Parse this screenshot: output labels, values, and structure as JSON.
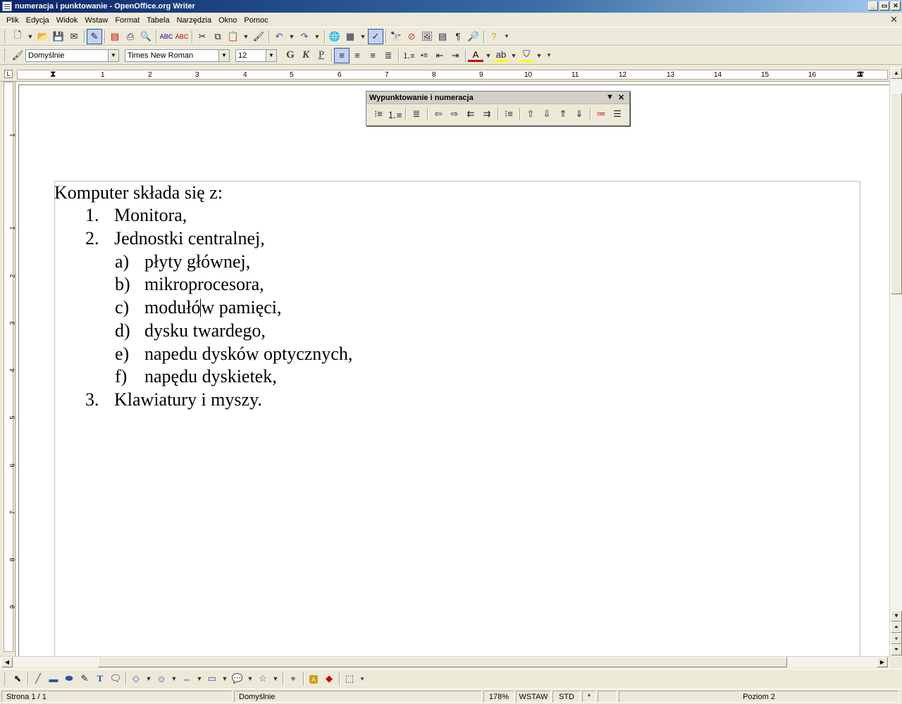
{
  "window": {
    "title": "numeracja i punktowanie - OpenOffice.org Writer",
    "minimize": "_",
    "restore": "▭",
    "close": "✕",
    "doc_close": "✕"
  },
  "menu": [
    {
      "label": "Plik"
    },
    {
      "label": "Edycja"
    },
    {
      "label": "Widok"
    },
    {
      "label": "Wstaw"
    },
    {
      "label": "Format"
    },
    {
      "label": "Tabela"
    },
    {
      "label": "Narzędzia"
    },
    {
      "label": "Okno"
    },
    {
      "label": "Pomoc"
    }
  ],
  "format_toolbar": {
    "style_value": "Domyślnie",
    "font_value": "Times New Roman",
    "size_value": "12",
    "bold": "G",
    "italic": "K",
    "underline": "P"
  },
  "ruler": {
    "h_numbers": [
      "1",
      "2",
      "3",
      "4",
      "5",
      "6",
      "7",
      "8",
      "9",
      "10",
      "11",
      "12",
      "13",
      "14",
      "15",
      "16",
      "17"
    ],
    "v_numbers": [
      "1",
      "1",
      "2",
      "3",
      "4",
      "5",
      "6",
      "7",
      "8",
      "9"
    ]
  },
  "panel": {
    "title": "Wypunktowanie i numeracja",
    "menu_arrow": "▼",
    "close": "✕"
  },
  "document": {
    "intro": "Komputer składa się z:",
    "items": [
      {
        "num": "1.",
        "text": "Monitora,"
      },
      {
        "num": "2.",
        "text": "Jednostki centralnej,"
      },
      {
        "num": "3.",
        "text": "Klawiatury i myszy."
      }
    ],
    "subitems": [
      {
        "num": "a)",
        "text": "płyty głównej,"
      },
      {
        "num": "b)",
        "text": "mikroprocesora,"
      },
      {
        "num": "c)",
        "text_before_cursor": "modułó",
        "text_after_cursor": "w pamięci,"
      },
      {
        "num": "d)",
        "text": "dysku twardego,"
      },
      {
        "num": "e)",
        "text": "napedu dysków optycznych,"
      },
      {
        "num": "f)",
        "text": "napędu dyskietek,"
      }
    ]
  },
  "status": {
    "page": "Strona  1 / 1",
    "style": "Domyślnie",
    "zoom": "178%",
    "mode": "WSTAW",
    "selection": "STD",
    "modified": "*",
    "level": "Poziom 2"
  }
}
